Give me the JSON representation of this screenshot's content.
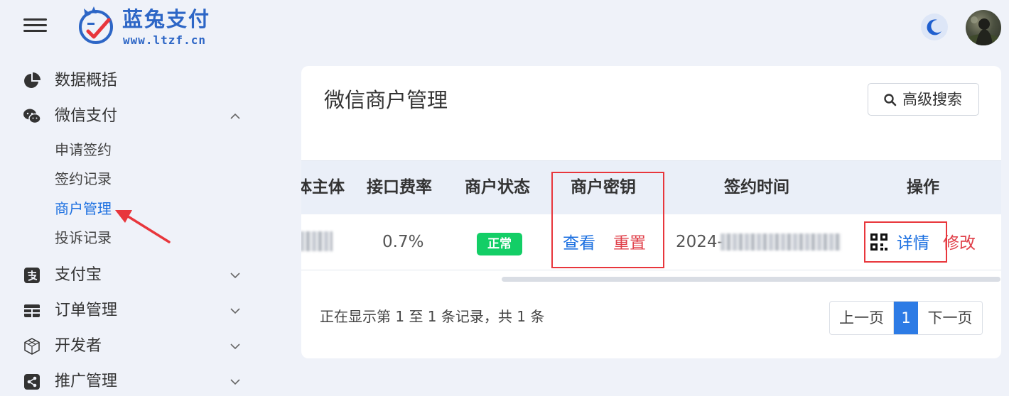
{
  "header": {
    "logo_title": "蓝兔支付",
    "logo_url": "www.ltzf.cn",
    "menu_icon": "hamburger-icon",
    "theme_icon": "moon-icon",
    "accent_color": "#2d66c6"
  },
  "sidebar": {
    "items": [
      {
        "label": "数据概括",
        "icon": "pie-chart-icon"
      },
      {
        "label": "微信支付",
        "icon": "wechat-icon",
        "expanded": true
      },
      {
        "label": "支付宝",
        "icon": "alipay-icon"
      },
      {
        "label": "订单管理",
        "icon": "table-icon"
      },
      {
        "label": "开发者",
        "icon": "cube-icon"
      },
      {
        "label": "推广管理",
        "icon": "share-icon"
      }
    ],
    "wechat_sub": [
      {
        "label": "申请签约"
      },
      {
        "label": "签约记录"
      },
      {
        "label": "商户管理",
        "active": true
      },
      {
        "label": "投诉记录"
      }
    ],
    "active_color": "#1b6fe0"
  },
  "main": {
    "title": "微信商户管理",
    "advanced_search": "高级搜索",
    "columns": [
      "体主体",
      "接口费率",
      "商户状态",
      "商户密钥",
      "签约时间",
      "操作"
    ],
    "row": {
      "rate": "0.7%",
      "status": "正常",
      "key_view": "查看",
      "key_reset": "重置",
      "sign_time_prefix": "2024-",
      "action_detail": "详情",
      "action_edit": "修改"
    },
    "footer": {
      "info": "正在显示第 1 至 1 条记录，共 1 条",
      "prev": "上一页",
      "page": "1",
      "next": "下一页"
    }
  },
  "colors": {
    "link_blue": "#1b6fe0",
    "link_red": "#e0404a",
    "status_green": "#13ce66",
    "highlight_red": "#e8363c"
  }
}
